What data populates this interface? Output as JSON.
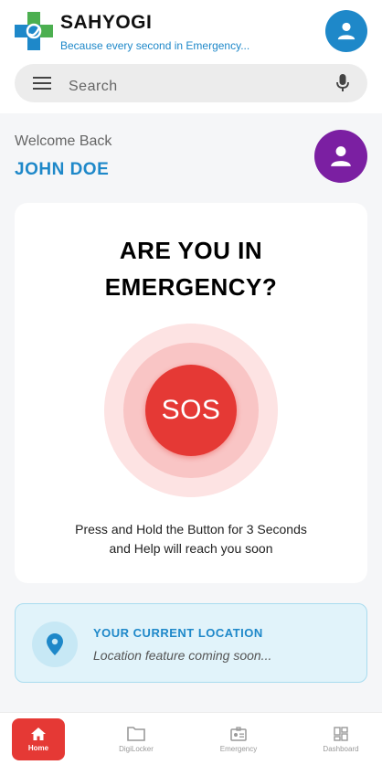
{
  "app": {
    "title": "SAHYOGI",
    "tagline": "Because every second in Emergency..."
  },
  "search": {
    "placeholder": "Search"
  },
  "welcome": {
    "greeting": "Welcome Back",
    "user_name": "JOHN DOE"
  },
  "sos_card": {
    "title_line1": "ARE YOU IN",
    "title_line2": "EMERGENCY?",
    "button_label": "SOS",
    "instruction_line1": "Press and Hold the Button for 3 Seconds",
    "instruction_line2": "and Help will reach you soon"
  },
  "location": {
    "title": "YOUR CURRENT LOCATION",
    "status": "Location feature coming soon..."
  },
  "bottom_nav": {
    "items": [
      {
        "label": "Home",
        "icon": "home-icon",
        "active": true
      },
      {
        "label": "DigiLocker",
        "icon": "folder-icon",
        "active": false
      },
      {
        "label": "Emergency",
        "icon": "id-card-icon",
        "active": false
      },
      {
        "label": "Dashboard",
        "icon": "dashboard-icon",
        "active": false
      }
    ]
  },
  "colors": {
    "primary": "#1e88c9",
    "sos_red": "#e53935",
    "avatar_purple": "#7b1fa2",
    "location_bg": "#e1f3fa"
  }
}
